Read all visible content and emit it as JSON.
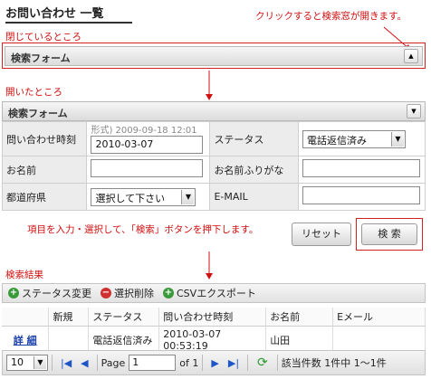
{
  "page": {
    "title": "お問い合わせ 一覧"
  },
  "notes": {
    "click_open": "クリックすると検索窓が開きます。",
    "closed_state": "閉じているところ",
    "open_state": "開いたところ",
    "enter_select": "項目を入力・選択して、「検索」ボタンを押下します。",
    "results": "検索結果"
  },
  "search_panel": {
    "title": "検索フォーム",
    "collapse_icon": "triangle-up",
    "expand_icon": "triangle-down"
  },
  "form": {
    "inquiry_datetime_label": "問い合わせ時刻",
    "inquiry_datetime_hint": "形式) 2009-09-18 12:01",
    "inquiry_datetime_value": "2010-03-07",
    "status_label": "ステータス",
    "status_value": "電話返信済み",
    "name_label": "お名前",
    "name_value": "",
    "kana_label": "お名前ふりがな",
    "kana_value": "",
    "prefecture_label": "都道府県",
    "prefecture_value": "選択して下さい",
    "email_label": "E-MAIL",
    "email_value": ""
  },
  "buttons": {
    "reset": "リセット",
    "search": "検 索"
  },
  "toolbar": {
    "status_change": "ステータス変更",
    "delete_selected": "選択削除",
    "csv_export": "CSVエクスポート"
  },
  "grid": {
    "columns": [
      "",
      "新規",
      "ステータス",
      "問い合わせ時刻",
      "お名前",
      "Eメール"
    ],
    "rows": [
      {
        "detail": "詳 細",
        "new": "",
        "status": "電話返信済み",
        "datetime": "2010-03-07 00:53:19",
        "name": "山田",
        "email": ""
      }
    ]
  },
  "pager": {
    "page_size": "10",
    "page_label": "Page",
    "page_value": "1",
    "of_label": "of 1",
    "summary": "該当件数 1件中 1～1件"
  },
  "colors": {
    "accent_red": "#d01010",
    "link_blue": "#1a3faa"
  }
}
